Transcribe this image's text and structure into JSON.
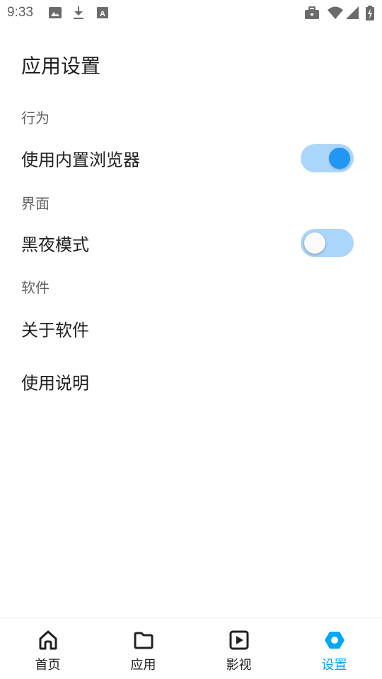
{
  "status_bar": {
    "time": "9:33",
    "left_icons": [
      "image-icon",
      "download-icon",
      "font-icon"
    ],
    "right_icons": [
      "briefcase-icon",
      "wifi-icon",
      "signal-icon",
      "battery-charging-icon"
    ]
  },
  "page": {
    "title": "应用设置"
  },
  "sections": [
    {
      "header": "行为",
      "item": {
        "label": "使用内置浏览器",
        "toggle": true
      }
    },
    {
      "header": "界面",
      "item": {
        "label": "黑夜模式",
        "toggle": false
      }
    },
    {
      "header": "软件",
      "items": [
        {
          "label": "关于软件"
        },
        {
          "label": "使用说明"
        }
      ]
    }
  ],
  "bottom_nav": {
    "items": [
      {
        "label": "首页",
        "icon": "home-icon",
        "active": false
      },
      {
        "label": "应用",
        "icon": "folder-icon",
        "active": false
      },
      {
        "label": "影视",
        "icon": "video-icon",
        "active": false
      },
      {
        "label": "设置",
        "icon": "settings-icon",
        "active": true
      }
    ]
  },
  "colors": {
    "accent": "#03a9f4",
    "switch_on_thumb": "#2196f3",
    "switch_track": "#aad6fb"
  }
}
